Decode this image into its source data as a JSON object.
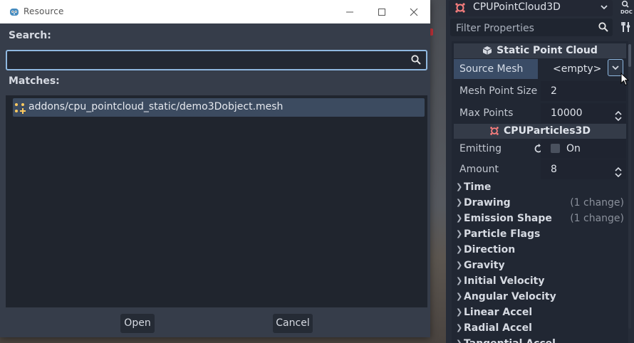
{
  "dialog": {
    "title": "Resource",
    "search_label": "Search:",
    "search_value": "",
    "matches_label": "Matches:",
    "matches": [
      {
        "path": "addons/cpu_pointcloud_static/demo3Dobject.mesh",
        "icon": "mesh-icon"
      }
    ],
    "open_label": "Open",
    "cancel_label": "Cancel"
  },
  "inspector": {
    "node_name": "CPUPointCloud3D",
    "filter_placeholder": "Filter Properties",
    "sections": {
      "static": {
        "title": "Static Point Cloud",
        "source_mesh_label": "Source Mesh",
        "source_mesh_value": "<empty>",
        "mesh_point_size_label": "Mesh Point Size",
        "mesh_point_size_value": "2",
        "max_points_label": "Max Points",
        "max_points_value": "10000"
      },
      "particles": {
        "title": "CPUParticles3D",
        "emitting_label": "Emitting",
        "emitting_value": "On",
        "amount_label": "Amount",
        "amount_value": "8"
      }
    },
    "groups": [
      {
        "title": "Time",
        "change": ""
      },
      {
        "title": "Drawing",
        "change": "(1 change)"
      },
      {
        "title": "Emission Shape",
        "change": "(1 change)"
      },
      {
        "title": "Particle Flags",
        "change": ""
      },
      {
        "title": "Direction",
        "change": ""
      },
      {
        "title": "Gravity",
        "change": ""
      },
      {
        "title": "Initial Velocity",
        "change": ""
      },
      {
        "title": "Angular Velocity",
        "change": ""
      },
      {
        "title": "Linear Accel",
        "change": ""
      },
      {
        "title": "Radial Accel",
        "change": ""
      },
      {
        "title": "Tangential Accel",
        "change": ""
      }
    ]
  },
  "colors": {
    "accent": "#8fb8e0",
    "node_red": "#fc7f7f",
    "selection": "#3c4b60"
  }
}
